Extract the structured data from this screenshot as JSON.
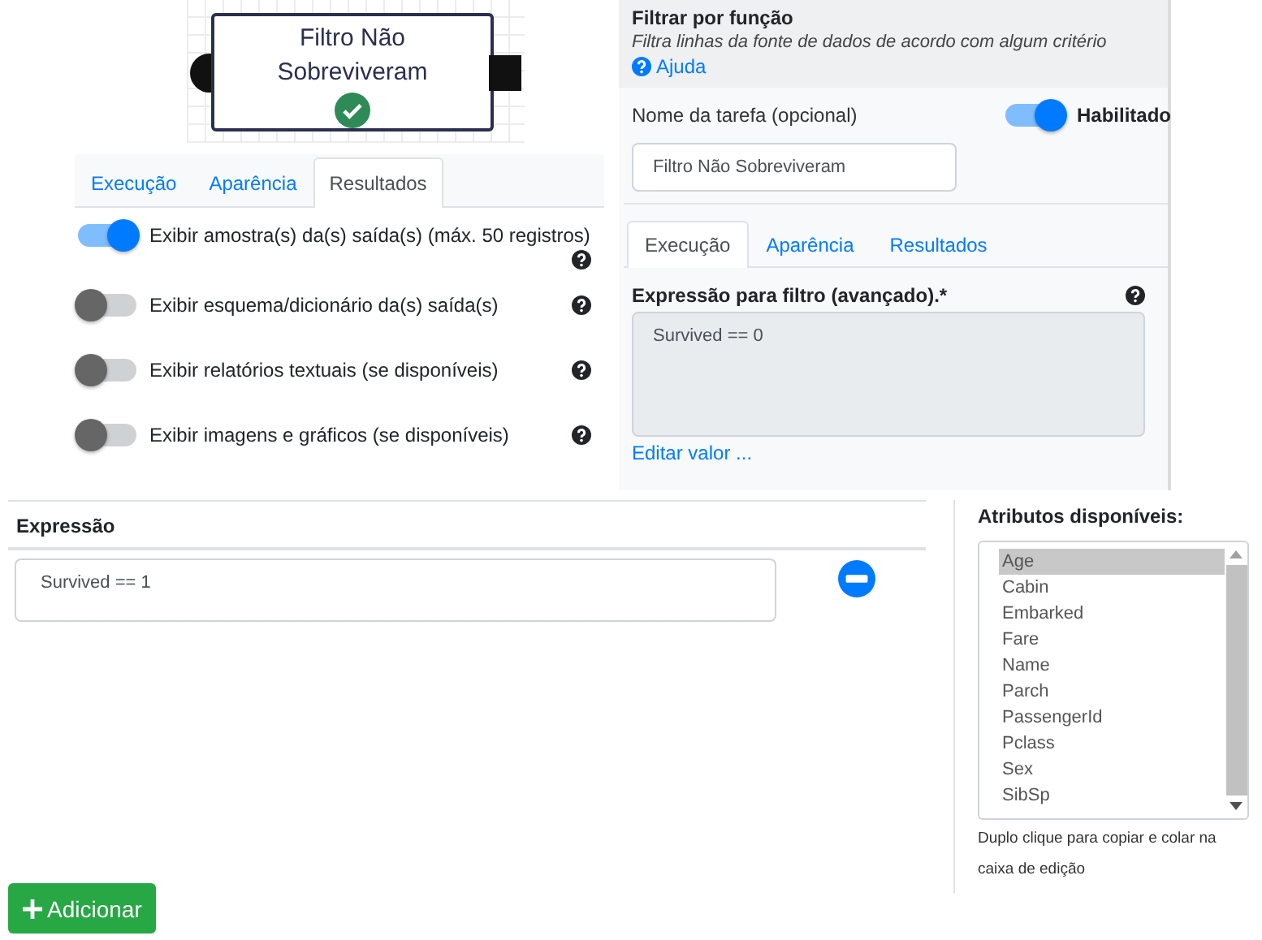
{
  "node": {
    "title": "Filtro Não Sobreviveram",
    "completed": true
  },
  "results_tabs": [
    {
      "label": "Execução",
      "selected": false
    },
    {
      "label": "Aparência",
      "selected": false
    },
    {
      "label": "Resultados",
      "selected": true
    }
  ],
  "toggles": [
    {
      "label": "Exibir amostra(s) da(s) saída(s) (máx. 50 registros)",
      "on": true
    },
    {
      "label": "Exibir esquema/dicionário da(s) saída(s)",
      "on": false
    },
    {
      "label": "Exibir relatórios textuais (se disponíveis)",
      "on": false
    },
    {
      "label": "Exibir imagens e gráficos (se disponíveis)",
      "on": false
    }
  ],
  "panel": {
    "title": "Filtrar por função",
    "description": "Filtra linhas da fonte de dados de acordo com algum critério",
    "help_link": "Ajuda",
    "task_name_label": "Nome da tarefa (opcional)",
    "enabled_toggle": {
      "label": "Habilitado",
      "on": true
    },
    "task_name_value": "Filtro Não Sobreviveram",
    "tabs": [
      {
        "label": "Execução",
        "selected": true
      },
      {
        "label": "Aparência",
        "selected": false
      },
      {
        "label": "Resultados",
        "selected": false
      }
    ],
    "expression_label": "Expressão para filtro (avançado).*",
    "expression_value": "Survived == 0",
    "edit_link": "Editar valor ..."
  },
  "expressions": {
    "header": "Expressão",
    "rows": [
      {
        "value": "Survived == 1"
      }
    ]
  },
  "attributes": {
    "title": "Atributos disponíveis:",
    "items": [
      {
        "label": "Age",
        "selected": true
      },
      {
        "label": "Cabin",
        "selected": false
      },
      {
        "label": "Embarked",
        "selected": false
      },
      {
        "label": "Fare",
        "selected": false
      },
      {
        "label": "Name",
        "selected": false
      },
      {
        "label": "Parch",
        "selected": false
      },
      {
        "label": "PassengerId",
        "selected": false
      },
      {
        "label": "Pclass",
        "selected": false
      },
      {
        "label": "Sex",
        "selected": false
      },
      {
        "label": "SibSp",
        "selected": false
      }
    ],
    "hint": "Duplo clique para copiar e colar na caixa de edição"
  },
  "add_button": "Adicionar"
}
